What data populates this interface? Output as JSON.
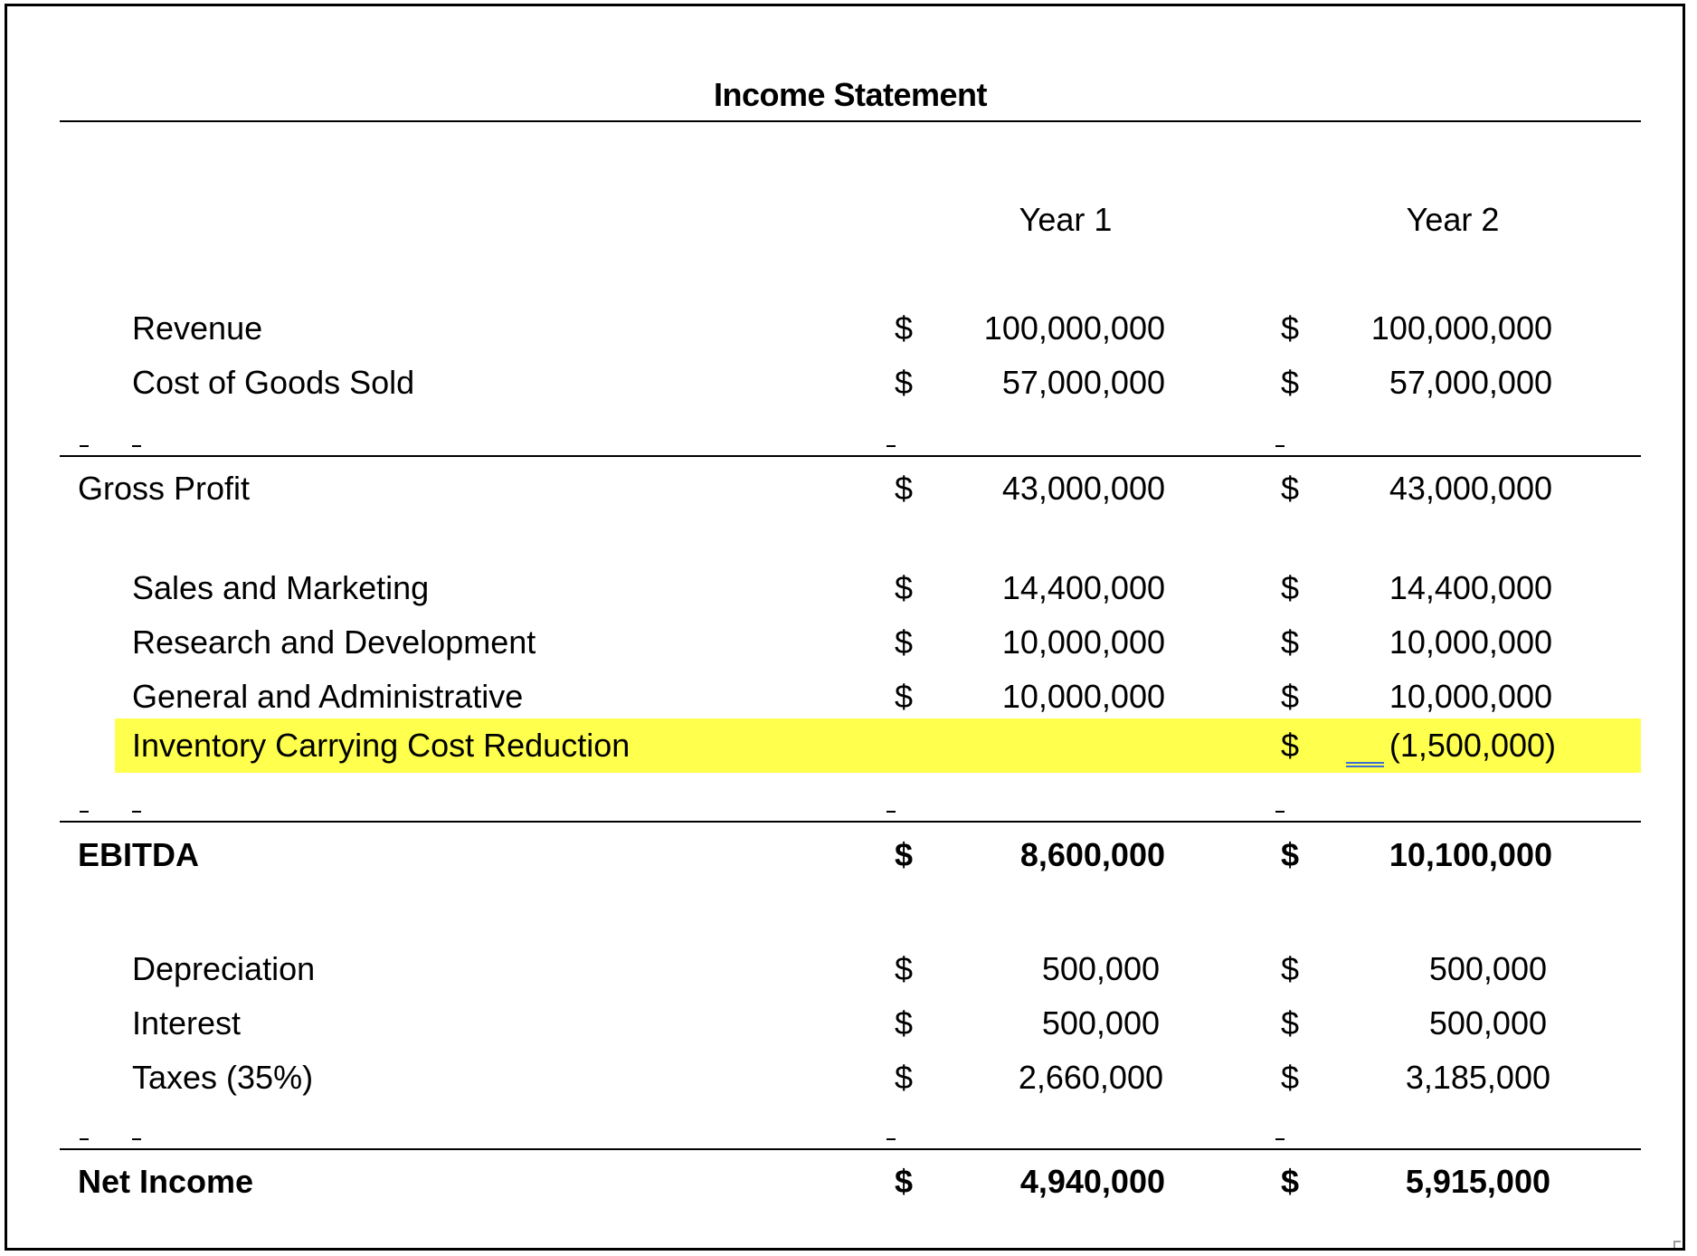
{
  "title": "Income Statement",
  "columns": [
    "Year 1",
    "Year 2"
  ],
  "currency_symbol": "$",
  "rows": {
    "revenue": {
      "label": "Revenue",
      "year1": "100,000,000",
      "year2": "100,000,000"
    },
    "cogs": {
      "label": "Cost of Goods Sold",
      "year1": "57,000,000",
      "year2": "57,000,000"
    },
    "gross_profit": {
      "label": "Gross Profit",
      "year1": "43,000,000",
      "year2": "43,000,000"
    },
    "sales_marketing": {
      "label": "Sales and Marketing",
      "year1": "14,400,000",
      "year2": "14,400,000"
    },
    "rnd": {
      "label": "Research and Development",
      "year1": "10,000,000",
      "year2": "10,000,000"
    },
    "gna": {
      "label": "General and Administrative",
      "year1": "10,000,000",
      "year2": "10,000,000"
    },
    "inventory": {
      "label": "Inventory Carrying Cost Reduction",
      "year1": "",
      "year2": "(1,500,000)"
    },
    "ebitda": {
      "label": "EBITDA",
      "year1": "8,600,000",
      "year2": "10,100,000"
    },
    "depreciation": {
      "label": "Depreciation",
      "year1": "500,000",
      "year2": "500,000"
    },
    "interest": {
      "label": "Interest",
      "year1": "500,000",
      "year2": "500,000"
    },
    "taxes": {
      "label": "Taxes (35%)",
      "year1": "2,660,000",
      "year2": "3,185,000"
    },
    "net_income": {
      "label": "Net Income",
      "year1": "4,940,000",
      "year2": "5,915,000"
    }
  },
  "highlight_color": "#ffff4d"
}
